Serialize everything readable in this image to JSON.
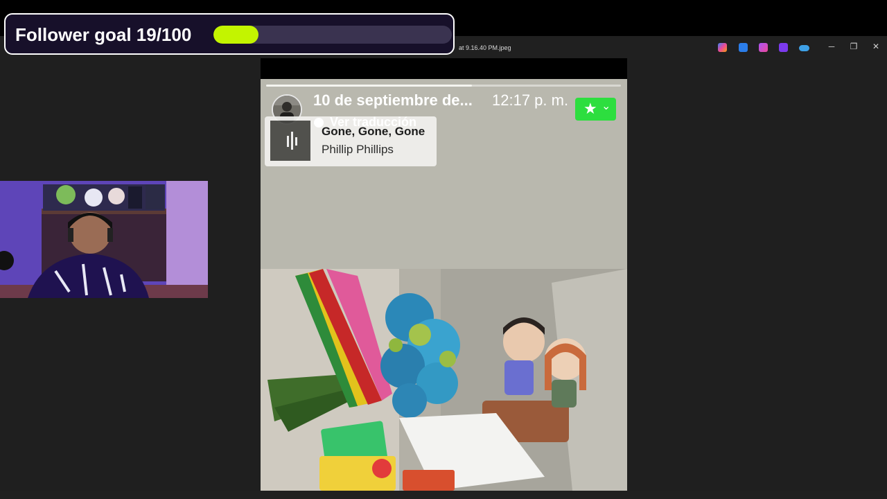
{
  "goal": {
    "label": "Follower goal 19/100",
    "current": 19,
    "target": 100,
    "progress_fraction": 0.19,
    "fill_color": "#c3f400",
    "track_color": "#3a3350"
  },
  "window": {
    "title_fragment": "at 9.16.40 PM.jpeg",
    "tray_icons": [
      "copilot-icon",
      "photos-edit-icon",
      "designer-icon",
      "clipchamp-icon",
      "onedrive-icon"
    ],
    "controls": {
      "minimize": "─",
      "restore": "❐",
      "close": "✕"
    }
  },
  "story": {
    "date": "10 de septiembre de...",
    "time": "12:17 p. m.",
    "translate_label": "Ver traducción",
    "star_icon": "★",
    "chevron_icon": "⌄",
    "accent_color": "#2dde3f",
    "music": {
      "song": "Gone, Gone, Gone",
      "artist": "Phillip Phillips",
      "icon": "audio-wave-icon"
    },
    "photo_subject": "blue-flower-bouquet-and-couple-figurines"
  }
}
